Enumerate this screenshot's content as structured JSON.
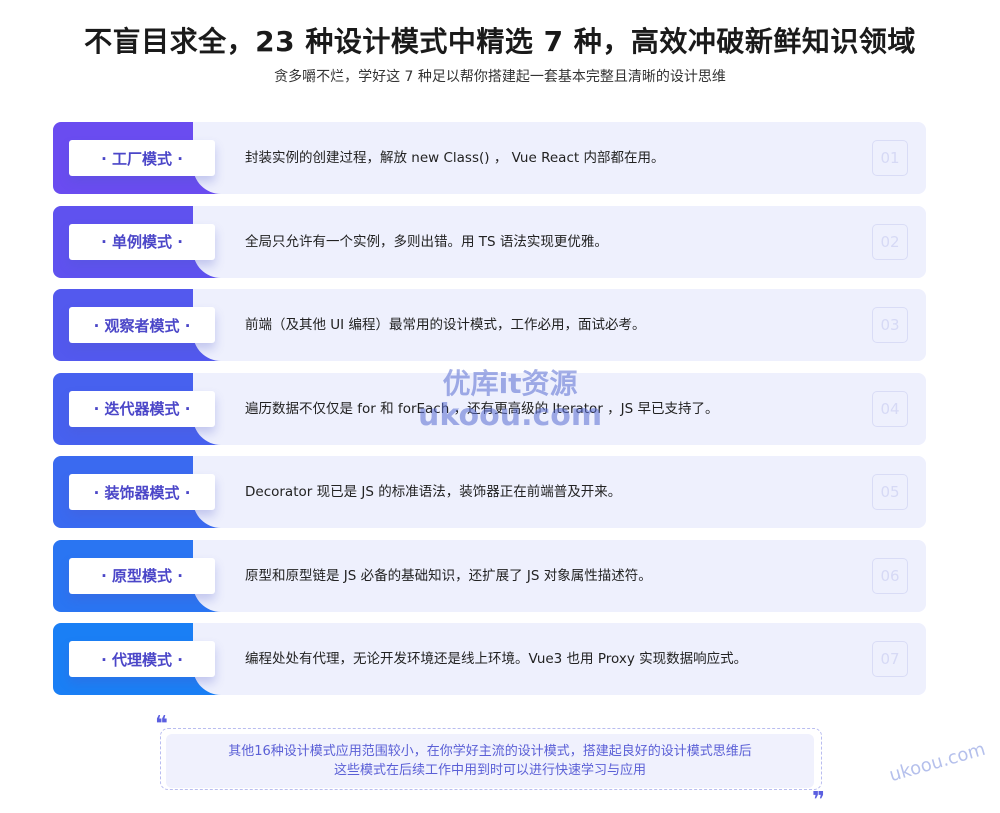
{
  "header": {
    "title": "不盲目求全，23 种设计模式中精选 7 种，高效冲破新鲜知识领域",
    "subtitle": "贪多嚼不烂，学好这 7 种足以帮你搭建起一套基本完整且清晰的设计思维"
  },
  "patterns": [
    {
      "name": "· 工厂模式 ·",
      "desc": "封装实例的创建过程，解放 new Class() ， Vue React 内部都在用。",
      "num": "01",
      "color": "#6a4cf0"
    },
    {
      "name": "· 单例模式 ·",
      "desc": "全局只允许有一个实例，多则出错。用 TS 语法实现更优雅。",
      "num": "02",
      "color": "#5f52ef"
    },
    {
      "name": "· 观察者模式 ·",
      "desc": "前端（及其他 UI 编程）最常用的设计模式，工作必用，面试必考。",
      "num": "03",
      "color": "#5359ee"
    },
    {
      "name": "· 迭代器模式 ·",
      "desc": "遍历数据不仅仅是 for 和 forEach ，还有更高级的 Iterator ，JS 早已支持了。",
      "num": "04",
      "color": "#4761ef"
    },
    {
      "name": "· 装饰器模式 ·",
      "desc": "Decorator 现已是 JS 的标准语法，装饰器正在前端普及开来。",
      "num": "05",
      "color": "#3a6af0"
    },
    {
      "name": "· 原型模式 ·",
      "desc": "原型和原型链是 JS 必备的基础知识，还扩展了 JS 对象属性描述符。",
      "num": "06",
      "color": "#2a75f2"
    },
    {
      "name": "· 代理模式 ·",
      "desc": "编程处处有代理，无论开发环境还是线上环境。Vue3 也用 Proxy 实现数据响应式。",
      "num": "07",
      "color": "#1a7ff5"
    }
  ],
  "note": {
    "line1": "其他16种设计模式应用范围较小，在你学好主流的设计模式，搭建起良好的设计模式思维后",
    "line2": "这些模式在后续工作中用到时可以进行快速学习与应用",
    "open_quote": "❝",
    "close_quote": "❞"
  },
  "watermark": {
    "line1": "优库it资源",
    "line2": "ukoou.com",
    "corner": "ukoou.com"
  }
}
